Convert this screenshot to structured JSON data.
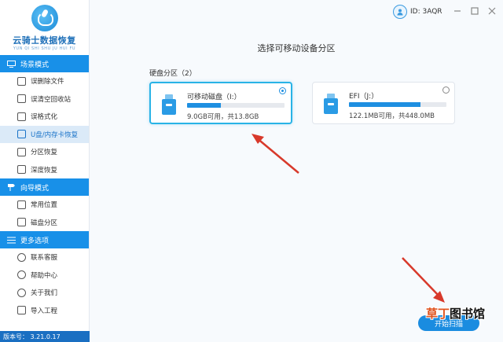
{
  "app": {
    "name": "云骑士数据恢复",
    "subtitle": "YUN QI SHI SHU JU HUI FU",
    "user_id": "ID: 3AQR",
    "version": "版本号： 3.21.0.17"
  },
  "sidebar": {
    "sections": [
      {
        "title": "场景模式",
        "items": [
          {
            "label": "误删除文件",
            "active": false
          },
          {
            "label": "误清空回收站",
            "active": false
          },
          {
            "label": "误格式化",
            "active": false
          },
          {
            "label": "U盘/内存卡恢复",
            "active": true
          },
          {
            "label": "分区恢复",
            "active": false
          },
          {
            "label": "深度恢复",
            "active": false
          }
        ]
      },
      {
        "title": "向导模式",
        "items": [
          {
            "label": "常用位置",
            "active": false
          },
          {
            "label": "磁盘分区",
            "active": false
          }
        ]
      },
      {
        "title": "更多选项",
        "items": [
          {
            "label": "联系客服",
            "active": false
          },
          {
            "label": "帮助中心",
            "active": false
          },
          {
            "label": "关于我们",
            "active": false
          },
          {
            "label": "导入工程",
            "active": false
          }
        ]
      }
    ]
  },
  "main": {
    "title": "选择可移动设备分区",
    "group_label": "硬盘分区（2）",
    "disks": [
      {
        "name": "可移动磁盘（I:）",
        "size": "9.0GB可用，共13.8GB",
        "used_fraction": 0.35,
        "selected": true
      },
      {
        "name": "EFI（J:）",
        "size": "122.1MB可用，共448.0MB",
        "used_fraction": 0.73,
        "selected": false
      }
    ],
    "start_button": "开始扫描"
  },
  "watermark": {
    "part1": "草丁",
    "part2": "图书馆"
  },
  "colors": {
    "accent": "#1890e8",
    "active_bg": "#dbeaf8",
    "selected_border": "#29b3e6",
    "arrow": "#d8392b"
  }
}
